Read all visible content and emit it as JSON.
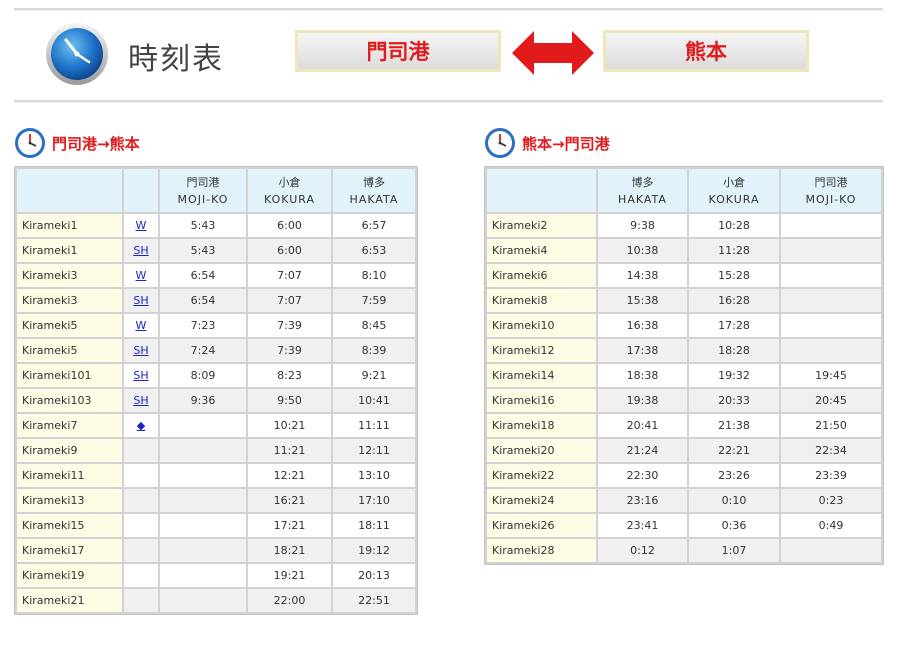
{
  "header": {
    "title": "時刻表",
    "from_button": "門司港",
    "to_button": "熊本"
  },
  "left_section": {
    "title": "門司港→熊本",
    "columns": [
      {
        "jp": "",
        "en": ""
      },
      {
        "jp": "",
        "en": ""
      },
      {
        "jp": "門司港",
        "en": "MOJI-KO"
      },
      {
        "jp": "小倉",
        "en": "KOKURA"
      },
      {
        "jp": "博多",
        "en": "HAKATA"
      }
    ],
    "rows": [
      {
        "train": "Kirameki1",
        "link": "W",
        "moji": "5:43",
        "kokura": "6:00",
        "hakata": "6:57"
      },
      {
        "train": "Kirameki1",
        "link": "SH",
        "moji": "5:43",
        "kokura": "6:00",
        "hakata": "6:53"
      },
      {
        "train": "Kirameki3",
        "link": "W",
        "moji": "6:54",
        "kokura": "7:07",
        "hakata": "8:10"
      },
      {
        "train": "Kirameki3",
        "link": "SH",
        "moji": "6:54",
        "kokura": "7:07",
        "hakata": "7:59"
      },
      {
        "train": "Kirameki5",
        "link": "W",
        "moji": "7:23",
        "kokura": "7:39",
        "hakata": "8:45"
      },
      {
        "train": "Kirameki5",
        "link": "SH",
        "moji": "7:24",
        "kokura": "7:39",
        "hakata": "8:39"
      },
      {
        "train": "Kirameki101",
        "link": "SH",
        "moji": "8:09",
        "kokura": "8:23",
        "hakata": "9:21"
      },
      {
        "train": "Kirameki103",
        "link": "SH",
        "moji": "9:36",
        "kokura": "9:50",
        "hakata": "10:41"
      },
      {
        "train": "Kirameki7",
        "link": "◆",
        "moji": "",
        "kokura": "10:21",
        "hakata": "11:11"
      },
      {
        "train": "Kirameki9",
        "link": "",
        "moji": "",
        "kokura": "11:21",
        "hakata": "12:11"
      },
      {
        "train": "Kirameki11",
        "link": "",
        "moji": "",
        "kokura": "12:21",
        "hakata": "13:10"
      },
      {
        "train": "Kirameki13",
        "link": "",
        "moji": "",
        "kokura": "16:21",
        "hakata": "17:10"
      },
      {
        "train": "Kirameki15",
        "link": "",
        "moji": "",
        "kokura": "17:21",
        "hakata": "18:11"
      },
      {
        "train": "Kirameki17",
        "link": "",
        "moji": "",
        "kokura": "18:21",
        "hakata": "19:12"
      },
      {
        "train": "Kirameki19",
        "link": "",
        "moji": "",
        "kokura": "19:21",
        "hakata": "20:13"
      },
      {
        "train": "Kirameki21",
        "link": "",
        "moji": "",
        "kokura": "22:00",
        "hakata": "22:51"
      }
    ]
  },
  "right_section": {
    "title": "熊本→門司港",
    "columns": [
      {
        "jp": "",
        "en": ""
      },
      {
        "jp": "博多",
        "en": "HAKATA"
      },
      {
        "jp": "小倉",
        "en": "KOKURA"
      },
      {
        "jp": "門司港",
        "en": "MOJI-KO"
      }
    ],
    "rows": [
      {
        "train": "Kirameki2",
        "hakata": "9:38",
        "kokura": "10:28",
        "moji": ""
      },
      {
        "train": "Kirameki4",
        "hakata": "10:38",
        "kokura": "11:28",
        "moji": ""
      },
      {
        "train": "Kirameki6",
        "hakata": "14:38",
        "kokura": "15:28",
        "moji": ""
      },
      {
        "train": "Kirameki8",
        "hakata": "15:38",
        "kokura": "16:28",
        "moji": ""
      },
      {
        "train": "Kirameki10",
        "hakata": "16:38",
        "kokura": "17:28",
        "moji": ""
      },
      {
        "train": "Kirameki12",
        "hakata": "17:38",
        "kokura": "18:28",
        "moji": ""
      },
      {
        "train": "Kirameki14",
        "hakata": "18:38",
        "kokura": "19:32",
        "moji": "19:45"
      },
      {
        "train": "Kirameki16",
        "hakata": "19:38",
        "kokura": "20:33",
        "moji": "20:45"
      },
      {
        "train": "Kirameki18",
        "hakata": "20:41",
        "kokura": "21:38",
        "moji": "21:50"
      },
      {
        "train": "Kirameki20",
        "hakata": "21:24",
        "kokura": "22:21",
        "moji": "22:34"
      },
      {
        "train": "Kirameki22",
        "hakata": "22:30",
        "kokura": "23:26",
        "moji": "23:39"
      },
      {
        "train": "Kirameki24",
        "hakata": "23:16",
        "kokura": "0:10",
        "moji": "0:23"
      },
      {
        "train": "Kirameki26",
        "hakata": "23:41",
        "kokura": "0:36",
        "moji": "0:49"
      },
      {
        "train": "Kirameki28",
        "hakata": "0:12",
        "kokura": "1:07",
        "moji": ""
      }
    ]
  },
  "colors": {
    "accent_red": "#e11b1b",
    "header_cell": "#e1f2fb",
    "train_cell": "#fffce6",
    "link_blue": "#1a24c8"
  }
}
